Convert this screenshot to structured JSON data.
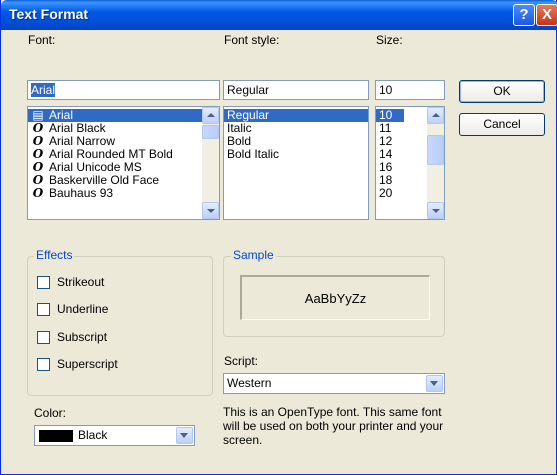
{
  "window": {
    "title": "Text Format"
  },
  "titlebar": {
    "help_glyph": "?",
    "close_glyph": "X"
  },
  "font": {
    "label": "Font:",
    "input_value": "Arial",
    "items": [
      {
        "label": "Arial",
        "icon": "printer-font-icon"
      },
      {
        "label": "Arial Black",
        "icon": "opentype-font-icon"
      },
      {
        "label": "Arial Narrow",
        "icon": "opentype-font-icon"
      },
      {
        "label": "Arial Rounded MT Bold",
        "icon": "opentype-font-icon"
      },
      {
        "label": "Arial Unicode MS",
        "icon": "opentype-font-icon"
      },
      {
        "label": "Baskerville Old Face",
        "icon": "opentype-font-icon"
      },
      {
        "label": "Bauhaus 93",
        "icon": "opentype-font-icon"
      }
    ]
  },
  "style": {
    "label": "Font style:",
    "input_value": "Regular",
    "items": [
      "Regular",
      "Italic",
      "Bold",
      "Bold Italic"
    ]
  },
  "size": {
    "label": "Size:",
    "input_value": "10",
    "items": [
      "10",
      "11",
      "12",
      "14",
      "16",
      "18",
      "20"
    ]
  },
  "buttons": {
    "ok": "OK",
    "cancel": "Cancel"
  },
  "effects": {
    "title": "Effects",
    "strikeout": "Strikeout",
    "underline": "Underline",
    "subscript": "Subscript",
    "superscript": "Superscript"
  },
  "sample": {
    "title": "Sample",
    "text": "AaBbYyZz"
  },
  "script": {
    "label": "Script:",
    "value": "Western"
  },
  "color": {
    "label": "Color:",
    "value": "Black",
    "swatch": "#000000"
  },
  "description": "This is an OpenType font. This same font will be used on both your printer and your screen.",
  "colors": {
    "accent": "#316ac5",
    "group_title": "#0046d5",
    "titlebar": "#0058e6"
  }
}
